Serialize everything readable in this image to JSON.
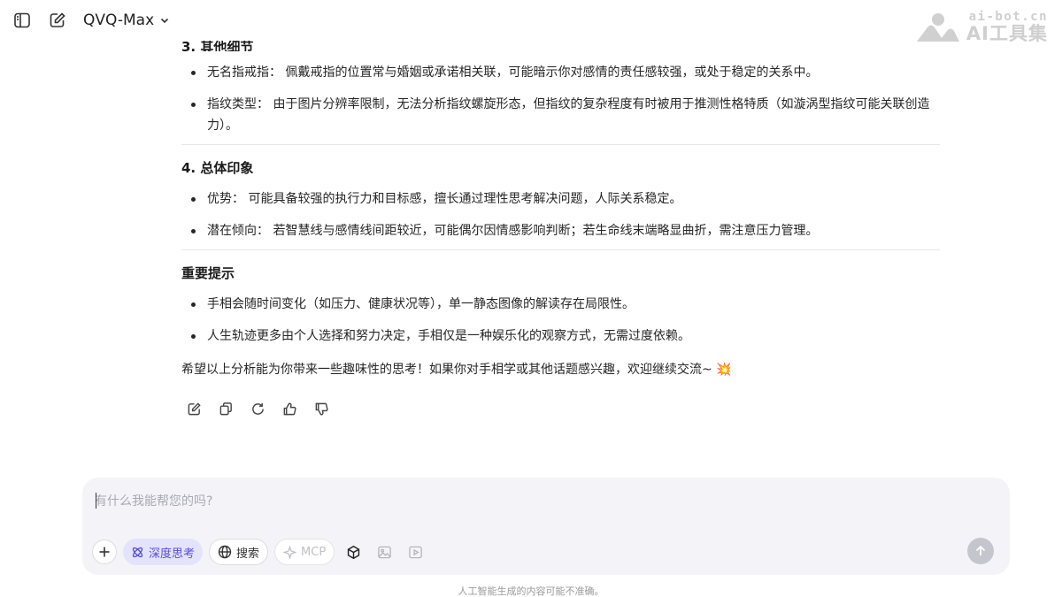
{
  "header": {
    "model_name": "QVQ-Max",
    "brand_small": "ai-bot.cn",
    "brand_big": "AI工具集"
  },
  "message": {
    "cut_heading": "3. 其他细节",
    "section3_items": [
      "无名指戒指： 佩戴戒指的位置常与婚姻或承诺相关联，可能暗示你对感情的责任感较强，或处于稳定的关系中。",
      "指纹类型： 由于图片分辨率限制，无法分析指纹螺旋形态，但指纹的复杂程度有时被用于推测性格特质（如漩涡型指纹可能关联创造力）。"
    ],
    "section4_title": "4. 总体印象",
    "section4_items": [
      "优势： 可能具备较强的执行力和目标感，擅长通过理性思考解决问题，人际关系稳定。",
      "潜在倾向： 若智慧线与感情线间距较近，可能偶尔因情感影响判断；若生命线末端略显曲折，需注意压力管理。"
    ],
    "notice_title": "重要提示",
    "notice_items": [
      "手相会随时间变化（如压力、健康状况等），单一静态图像的解读存在局限性。",
      "人生轨迹更多由个人选择和努力决定，手相仅是一种娱乐化的观察方式，无需过度依赖。"
    ],
    "closing": "希望以上分析能为你带来一些趣味性的思考！如果你对手相学或其他话题感兴趣，欢迎继续交流~ 💥"
  },
  "input": {
    "placeholder": "有什么我能帮您的吗?",
    "deep_think_label": "深度思考",
    "search_label": "搜索",
    "mcp_label": "MCP"
  },
  "footer": {
    "disclaimer": "人工智能生成的内容可能不准确。"
  },
  "colors": {
    "accent": "#5a4fd6",
    "accent_bg": "#e3e3fc",
    "input_bg": "#f4f4f8",
    "send_button": "#c5c5cd"
  }
}
